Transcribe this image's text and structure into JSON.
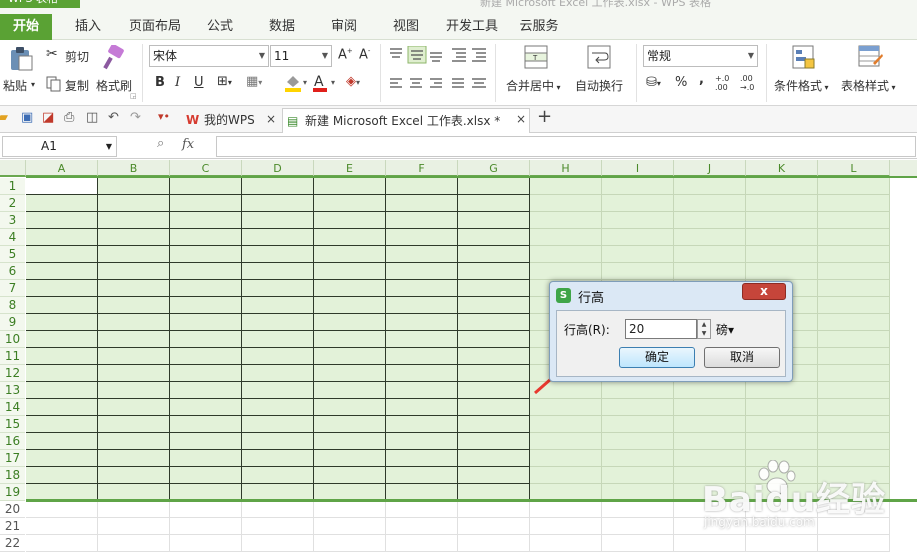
{
  "app": {
    "badge": "WPS 表格",
    "faint_title": "新建 Microsoft Excel 工作表.xlsx - WPS 表格"
  },
  "ribbon_tabs": [
    "开始",
    "插入",
    "页面布局",
    "公式",
    "数据",
    "审阅",
    "视图",
    "开发工具",
    "云服务"
  ],
  "ribbon": {
    "paste": "粘贴",
    "cut": "剪切",
    "copy": "复制",
    "format_painter": "格式刷",
    "font_name": "宋体",
    "font_size": "11",
    "merge_center": "合并居中",
    "wrap_text": "自动换行",
    "number_format": "常规",
    "conditional_format": "条件格式",
    "table_style": "表格样式",
    "percent": "%",
    "comma": ",",
    "dec_inc": "+.0 .00",
    "dec_dec": ".00 →.0"
  },
  "doc_tabs": [
    {
      "label": "我的WPS",
      "close": "×"
    },
    {
      "label": "新建 Microsoft Excel 工作表.xlsx *",
      "close": "×"
    }
  ],
  "new_tab": "+",
  "formula_bar": {
    "cell_ref": "A1",
    "fx": "fx",
    "zoom_icon": "search"
  },
  "columns": [
    "A",
    "B",
    "C",
    "D",
    "E",
    "F",
    "G",
    "H",
    "I",
    "J",
    "K",
    "L"
  ],
  "rows": [
    "1",
    "2",
    "3",
    "4",
    "5",
    "6",
    "7",
    "8",
    "9",
    "10",
    "11",
    "12",
    "13",
    "14",
    "15",
    "16",
    "17",
    "18",
    "19",
    "20",
    "21",
    "22"
  ],
  "dialog": {
    "title": "行高",
    "close": "x",
    "label": "行高(R):",
    "value": "20",
    "unit": "磅▾",
    "ok": "确定",
    "cancel": "取消"
  },
  "watermark": {
    "brand": "Baidu经验",
    "url": "jingyan.baidu.com"
  },
  "colors": {
    "accent": "#5aa234",
    "selection": "#e3f2d9",
    "annotation": "#e8392f"
  }
}
